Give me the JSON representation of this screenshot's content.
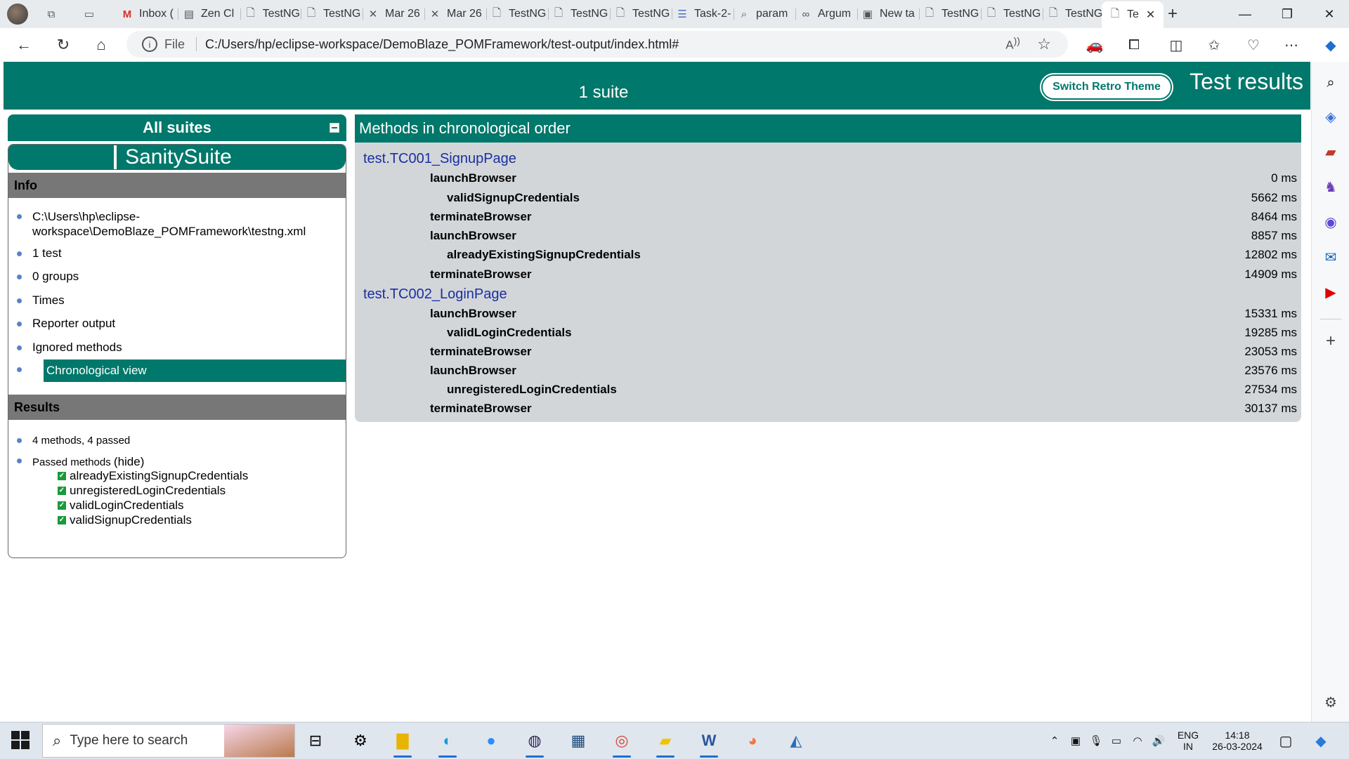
{
  "browser": {
    "tabs": [
      {
        "icon": "gmail-icon",
        "label": "Inbox ("
      },
      {
        "icon": "page-icon",
        "label": "Zen Cl"
      },
      {
        "icon": "file-icon",
        "label": "TestNG"
      },
      {
        "icon": "file-icon",
        "label": "TestNG"
      },
      {
        "icon": "tools-icon",
        "label": "Mar 26"
      },
      {
        "icon": "tools-icon",
        "label": "Mar 26"
      },
      {
        "icon": "file-icon",
        "label": "TestNG"
      },
      {
        "icon": "file-icon",
        "label": "TestNG"
      },
      {
        "icon": "file-icon",
        "label": "TestNG"
      },
      {
        "icon": "doc-icon",
        "label": "Task-2-"
      },
      {
        "icon": "search-icon",
        "label": "param"
      },
      {
        "icon": "link-icon",
        "label": "Argum"
      },
      {
        "icon": "newtab-icon",
        "label": "New ta"
      },
      {
        "icon": "file-icon",
        "label": "TestNG"
      },
      {
        "icon": "file-icon",
        "label": "TestNG"
      },
      {
        "icon": "file-icon",
        "label": "TestNG"
      }
    ],
    "active_tab": {
      "label": "Te"
    },
    "address": {
      "scheme_label": "File",
      "url": "C:/Users/hp/eclipse-workspace/DemoBlaze_POMFramework/test-output/index.html#"
    }
  },
  "report": {
    "suite_count": "1 suite",
    "retro_button": "Switch Retro Theme",
    "title": "Test results",
    "navigator": {
      "all_suites": "All suites",
      "suite_name": "SanitySuite",
      "info_header": "Info",
      "info_items": [
        "C:\\Users\\hp\\eclipse-",
        "workspace\\DemoBlaze_POMFramework\\testng.xml",
        "1 test",
        "0 groups",
        "Times",
        "Reporter output",
        "Ignored methods",
        "Chronological view"
      ],
      "results_header": "Results",
      "results_summary": "4 methods, 4 passed",
      "passed_label": "Passed methods",
      "hide_link": "(hide)",
      "passed_methods": [
        "alreadyExistingSignupCredentials",
        "unregisteredLoginCredentials",
        "validLoginCredentials",
        "validSignupCredentials"
      ]
    },
    "chrono": {
      "header": "Methods in chronological order",
      "classes": [
        {
          "name": "test.TC001_SignupPage",
          "methods": [
            {
              "name": "launchBrowser",
              "time": "0 ms"
            },
            {
              "name": "validSignupCredentials",
              "time": "5662 ms"
            },
            {
              "name": "terminateBrowser",
              "time": "8464 ms"
            },
            {
              "name": "launchBrowser",
              "time": "8857 ms"
            },
            {
              "name": "alreadyExistingSignupCredentials",
              "time": "12802 ms"
            },
            {
              "name": "terminateBrowser",
              "time": "14909 ms"
            }
          ]
        },
        {
          "name": "test.TC002_LoginPage",
          "methods": [
            {
              "name": "launchBrowser",
              "time": "15331 ms"
            },
            {
              "name": "validLoginCredentials",
              "time": "19285 ms"
            },
            {
              "name": "terminateBrowser",
              "time": "23053 ms"
            },
            {
              "name": "launchBrowser",
              "time": "23576 ms"
            },
            {
              "name": "unregisteredLoginCredentials",
              "time": "27534 ms"
            },
            {
              "name": "terminateBrowser",
              "time": "30137 ms"
            }
          ]
        }
      ]
    }
  },
  "taskbar": {
    "search_placeholder": "Type here to search",
    "lang_line1": "ENG",
    "lang_line2": "IN",
    "time": "14:18",
    "date": "26-03-2024"
  },
  "colors": {
    "accent": "#00786b",
    "section_gray": "#777777",
    "chrono_bg": "#d3d6d9",
    "class_link": "#1a2fa0"
  }
}
